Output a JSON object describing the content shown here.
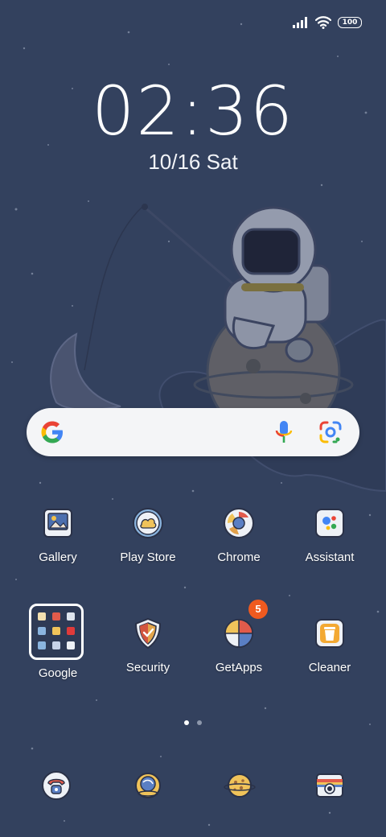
{
  "status_bar": {
    "battery_level": "100",
    "icons": [
      "signal-icon",
      "wifi-icon",
      "battery-icon"
    ]
  },
  "clock": {
    "time": "02:36",
    "date_numeric": "10/16",
    "date_day": "Sat"
  },
  "search_widget": {
    "icons": [
      "google-logo-icon",
      "microphone-icon",
      "google-lens-icon"
    ]
  },
  "apps_row_1": [
    {
      "label": "Gallery",
      "icon": "gallery-icon"
    },
    {
      "label": "Play Store",
      "icon": "play-store-icon"
    },
    {
      "label": "Chrome",
      "icon": "chrome-icon"
    },
    {
      "label": "Assistant",
      "icon": "assistant-icon"
    }
  ],
  "apps_row_2": [
    {
      "label": "Google",
      "icon": "google-folder-icon"
    },
    {
      "label": "Security",
      "icon": "security-shield-icon"
    },
    {
      "label": "GetApps",
      "icon": "getapps-icon",
      "badge": "5"
    },
    {
      "label": "Cleaner",
      "icon": "cleaner-trash-icon"
    }
  ],
  "page_indicator": {
    "pages": 2,
    "active": 1
  },
  "dock": [
    {
      "icon": "phone-icon"
    },
    {
      "icon": "browser-planet-icon"
    },
    {
      "icon": "messages-cookie-icon"
    },
    {
      "icon": "camera-icon"
    }
  ],
  "colors": {
    "background": "#33415e",
    "badge": "#ef5a1f",
    "google_blue": "#4285F4",
    "google_red": "#EA4335",
    "google_yellow": "#FBBC05",
    "google_green": "#34A853"
  }
}
